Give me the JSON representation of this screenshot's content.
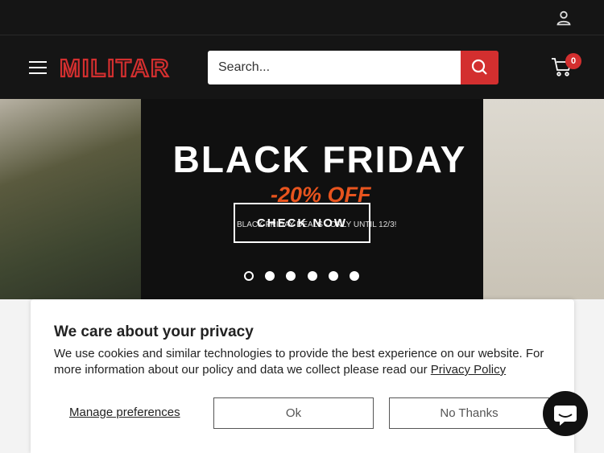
{
  "topbar": {
    "account_icon": "user-icon"
  },
  "header": {
    "brand": "MILITAR",
    "search_placeholder": "Search...",
    "cart_count": "0",
    "colors": {
      "accent": "#d32f2f",
      "background": "#151515"
    }
  },
  "hero": {
    "title": "BLACK FRIDAY",
    "subtitle": "-20% OFF",
    "cta_label": "CHECK NOW",
    "note": "BLACK FRIDAY DEALS - ONLY UNTIL 12/3!",
    "slide_count": 6,
    "active_slide": 1,
    "accent_color": "#e8541e"
  },
  "privacy": {
    "title": "We care about your privacy",
    "message": "We use cookies and similar technologies to provide the best experience on our website. For more information about our policy and data we collect please read our",
    "policy_link": "Privacy Policy",
    "manage_label": "Manage preferences",
    "ok_label": "Ok",
    "no_label": "No Thanks"
  },
  "chat": {
    "icon": "chat-icon"
  }
}
